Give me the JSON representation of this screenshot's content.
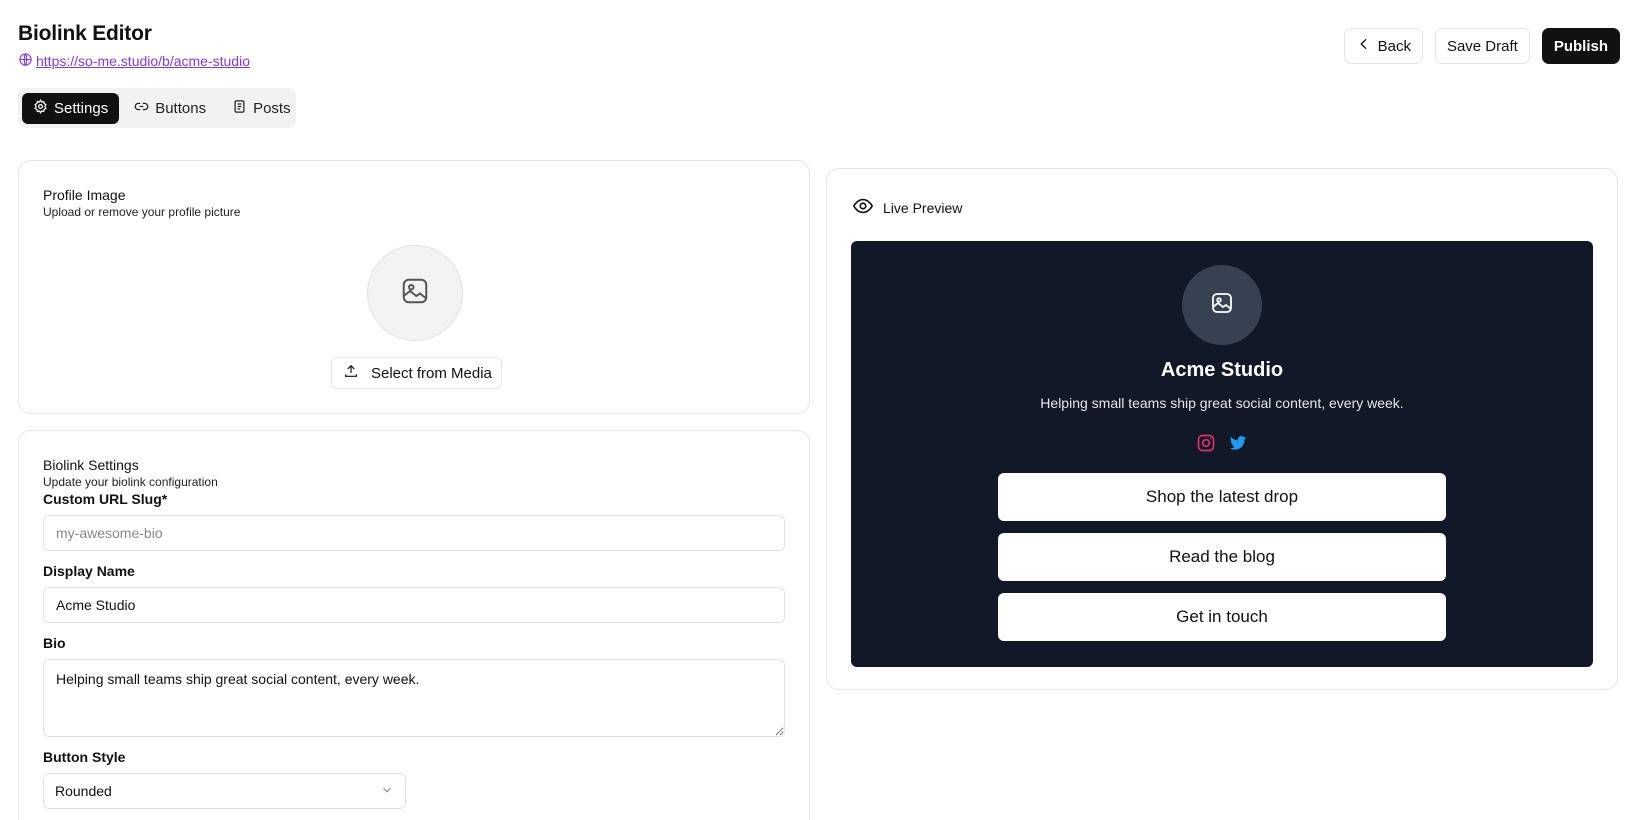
{
  "header": {
    "title": "Biolink Editor",
    "url": "https://so-me.studio/b/acme-studio",
    "back_label": "Back",
    "save_draft_label": "Save Draft",
    "publish_label": "Publish"
  },
  "tabs": [
    {
      "label": "Settings",
      "icon": "gear-icon",
      "active": true
    },
    {
      "label": "Buttons",
      "icon": "link-icon",
      "active": false
    },
    {
      "label": "Posts",
      "icon": "document-icon",
      "active": false
    }
  ],
  "profile_image": {
    "title": "Profile Image",
    "subtitle": "Upload or remove your profile picture",
    "select_media_label": "Select from Media"
  },
  "biolink_settings": {
    "title": "Biolink Settings",
    "subtitle": "Update your biolink configuration",
    "slug_label": "Custom URL Slug*",
    "slug_placeholder": "my-awesome-bio",
    "slug_value": "",
    "display_name_label": "Display Name",
    "display_name_value": "Acme Studio",
    "bio_label": "Bio",
    "bio_value": "Helping small teams ship great social content, every week.",
    "button_style_label": "Button Style",
    "button_style_value": "Rounded"
  },
  "preview": {
    "heading": "Live Preview",
    "name": "Acme Studio",
    "bio": "Helping small teams ship great social content, every week.",
    "social_icons": [
      "instagram-icon",
      "twitter-icon"
    ],
    "links": [
      "Shop the latest drop",
      "Read the blog",
      "Get in touch"
    ]
  },
  "colors": {
    "accent_link": "#7c3aed",
    "primary_button": "#111111",
    "preview_bg": "#111827",
    "instagram": "#e1306c",
    "twitter": "#1d9bf0"
  }
}
